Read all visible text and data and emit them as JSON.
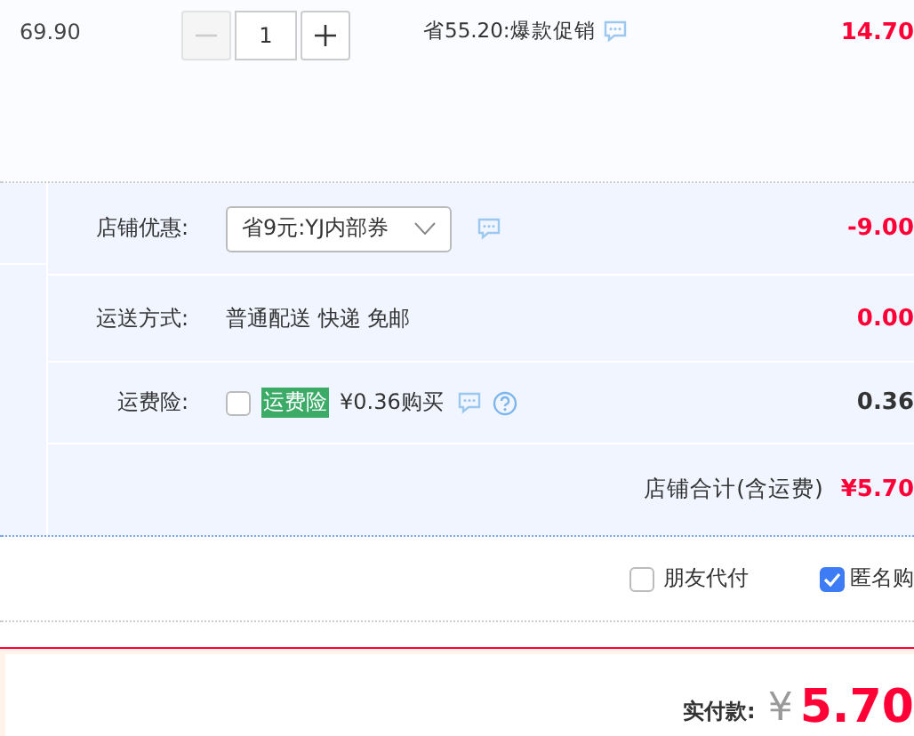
{
  "item": {
    "unit_price": "69.90",
    "quantity": {
      "value": "1",
      "minus_disabled": true,
      "plus_disabled": false
    },
    "promo": "省55.20:爆款促销",
    "subtotal": "14.70"
  },
  "shop": {
    "rows": [
      {
        "kind": "select",
        "label": "店铺优惠:",
        "value": "省9元:YJ内部券",
        "amount": "-9.00",
        "emphasis": true
      },
      {
        "kind": "text",
        "label": "运送方式:",
        "value": "普通配送 快递 免邮",
        "amount": "0.00",
        "emphasis": true
      },
      {
        "kind": "insurance",
        "label": "运费险:",
        "checked": false,
        "tag": "运费险",
        "value": "¥0.36购买",
        "amount": "0.36",
        "emphasis": false
      }
    ],
    "total": {
      "label": "店铺合计(含运费)",
      "amount": "¥5.70"
    }
  },
  "options": [
    {
      "label": "朋友代付",
      "checked": false
    },
    {
      "label": "匿名购",
      "checked": true
    }
  ],
  "payment": {
    "label": "实付款:",
    "currency": "¥",
    "amount": "5.70"
  }
}
